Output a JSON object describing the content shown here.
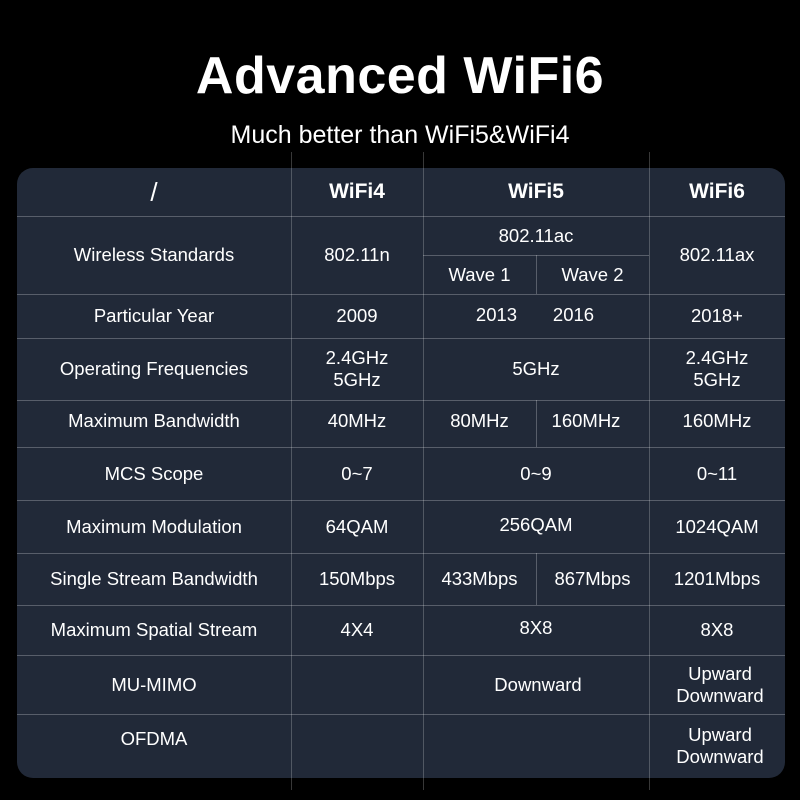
{
  "header": {
    "title": "Advanced WiFi6",
    "subtitle": "Much better than WiFi5&WiFi4"
  },
  "table": {
    "columns": [
      "/",
      "WiFi4",
      "WiFi5",
      "WiFi6"
    ],
    "rows": [
      {
        "label": "Wireless Standards",
        "wifi4": "802.11n",
        "wifi5": "802.11ac",
        "wifi5_sub": [
          "Wave 1",
          "Wave 2"
        ],
        "wifi6": "802.11ax"
      },
      {
        "label": "Particular Year",
        "wifi4": "2009",
        "wifi5_split": [
          "2013",
          "2016"
        ],
        "wifi6": "2018+"
      },
      {
        "label": "Operating Frequencies",
        "wifi4": "2.4GHz\n5GHz",
        "wifi5": "5GHz",
        "wifi6": "2.4GHz\n5GHz"
      },
      {
        "label": "Maximum Bandwidth",
        "wifi4": "40MHz",
        "wifi5_split": [
          "80MHz",
          "160MHz"
        ],
        "wifi6": "160MHz"
      },
      {
        "label": "MCS Scope",
        "wifi4": "0~7",
        "wifi5": "0~9",
        "wifi6": "0~11"
      },
      {
        "label": "Maximum Modulation",
        "wifi4": "64QAM",
        "wifi5": "256QAM",
        "wifi6": "1024QAM"
      },
      {
        "label": "Single Stream Bandwidth",
        "wifi4": "150Mbps",
        "wifi5_split": [
          "433Mbps",
          "867Mbps"
        ],
        "wifi6": "1201Mbps"
      },
      {
        "label": "Maximum Spatial Stream",
        "wifi4": "4X4",
        "wifi5": "8X8",
        "wifi6": "8X8"
      },
      {
        "label": "MU-MIMO",
        "wifi4": "",
        "wifi5": "Downward",
        "wifi6": "Upward\nDownward"
      },
      {
        "label": "OFDMA",
        "wifi4": "",
        "wifi5": "",
        "wifi6": "Upward\nDownward"
      }
    ]
  }
}
